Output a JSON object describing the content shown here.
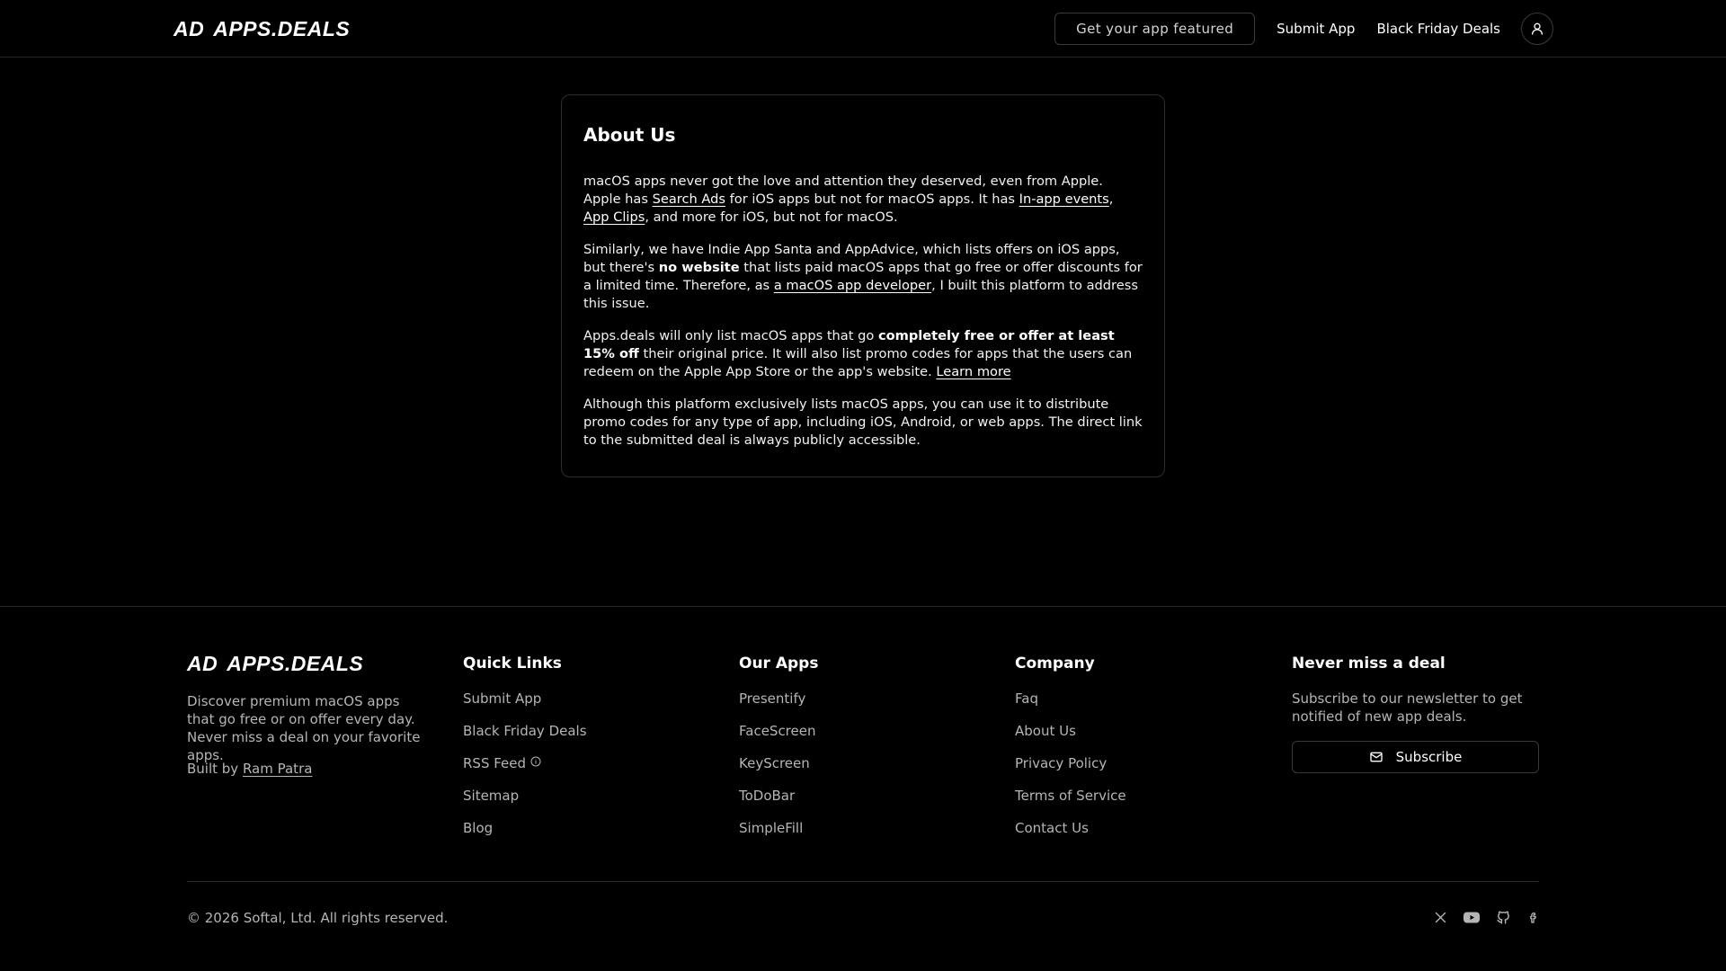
{
  "header": {
    "logo_mark": "AD",
    "logo_text": "APPS.DEALS",
    "featured_button": "Get your app featured",
    "nav": [
      "Submit App",
      "Black Friday Deals"
    ],
    "account_icon": "user-icon"
  },
  "about": {
    "title": "About Us",
    "p1": {
      "t1": "macOS apps never got the love and attention they deserved, even from Apple. Apple has ",
      "link1": "Search Ads",
      "t2": " for iOS apps but not for macOS apps. It has ",
      "link2": "In-app events",
      "t3": ", ",
      "link3": "App Clips",
      "t4": ", and more for iOS, but not for macOS."
    },
    "p2": {
      "t1": "Similarly, we have Indie App Santa and AppAdvice, which lists offers on iOS apps, but there's ",
      "bold": "no website",
      "t2": " that lists paid macOS apps that go free or offer discounts for a limited time. Therefore, as ",
      "link": "a macOS app developer",
      "t3": ", I built this platform to address this issue."
    },
    "p3": {
      "t1": "Apps.deals will only list macOS apps that go ",
      "bold": "completely free or offer at least 15% off",
      "t2": " their original price. It will also list promo codes for apps that the users can redeem on the Apple App Store or the app's website. ",
      "link": "Learn more"
    },
    "p4": "Although this platform exclusively lists macOS apps, you can use it to distribute promo codes for any type of app, including iOS, Android, or web apps. The direct link to the submitted deal is always publicly accessible."
  },
  "footer": {
    "logo_mark": "AD",
    "logo_text": "APPS.DEALS",
    "description": "Discover premium macOS apps that go free or on offer every day. Never miss a deal on your favorite apps.",
    "built_by_prefix": "Built by ",
    "built_by_name": "Ram Patra",
    "quick_links": {
      "title": "Quick Links",
      "items": [
        "Submit App",
        "Black Friday Deals",
        "RSS Feed",
        "Sitemap",
        "Blog"
      ]
    },
    "our_apps": {
      "title": "Our Apps",
      "items": [
        "Presentify",
        "FaceScreen",
        "KeyScreen",
        "ToDoBar",
        "SimpleFill"
      ]
    },
    "company": {
      "title": "Company",
      "items": [
        "Faq",
        "About Us",
        "Privacy Policy",
        "Terms of Service",
        "Contact Us"
      ]
    },
    "newsletter": {
      "title": "Never miss a deal",
      "description": "Subscribe to our newsletter to get notified of new app deals.",
      "button": "Subscribe",
      "button_icon": "mail-icon"
    },
    "copyright": "© 2026 Softal, Ltd. All rights reserved.",
    "socials": [
      "x-icon",
      "youtube-icon",
      "github-icon",
      "facebook-icon"
    ]
  }
}
